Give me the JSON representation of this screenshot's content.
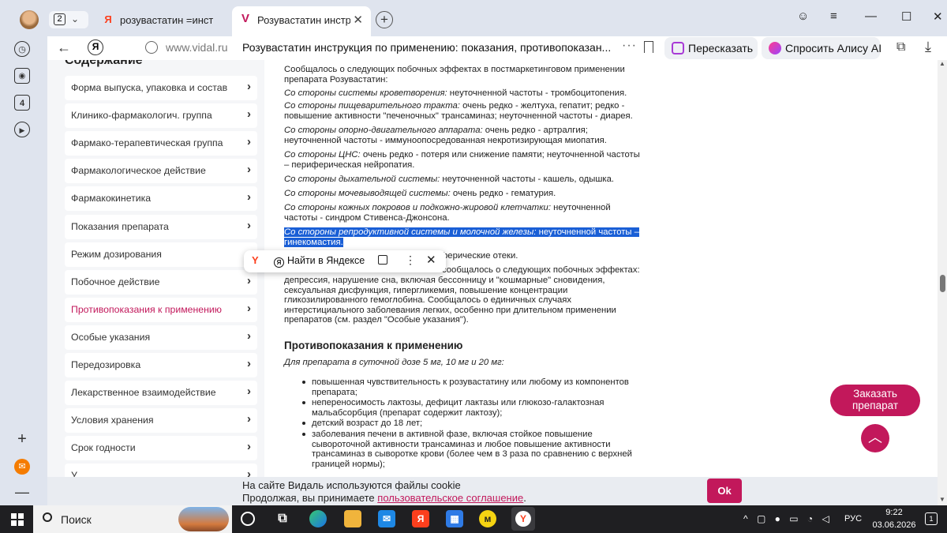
{
  "browser": {
    "tab_counter": "2",
    "tabs": [
      {
        "title": "розувастатин =инструкция",
        "favicon": "Я"
      },
      {
        "title": "Розувастатин инструкция",
        "favicon": "V"
      }
    ],
    "url": "www.vidal.ru",
    "page_title": "Розувастатин инструкция по применению: показания, противопоказан...",
    "retell_label": "Пересказать",
    "alice_label": "Спросить Алису AI",
    "sidebar_tabs_count": "4",
    "icons": [
      "back-arrow-icon",
      "yandex-icon",
      "lock-icon",
      "bookmark-icon",
      "download-icon",
      "extensions-icon"
    ]
  },
  "toc": {
    "heading": "Содержание",
    "items": [
      {
        "label": "Форма выпуска, упаковка и состав"
      },
      {
        "label": "Клинико-фармакологич. группа"
      },
      {
        "label": "Фармако-терапевтическая группа"
      },
      {
        "label": "Фармакологическое действие"
      },
      {
        "label": "Фармакокинетика"
      },
      {
        "label": "Показания препарата"
      },
      {
        "label": "Режим дозирования"
      },
      {
        "label": "Побочное действие"
      },
      {
        "label": "Противопоказания к применению"
      },
      {
        "label": "Особые указания"
      },
      {
        "label": "Передозировка"
      },
      {
        "label": "Лекарственное взаимодействие"
      },
      {
        "label": "Условия хранения"
      },
      {
        "label": "Срок годности"
      },
      {
        "label": "У..."
      }
    ],
    "active_index": 8,
    "active_color": "#c2185b"
  },
  "content": {
    "intro_1": "Сообщалось о следующих побочных эффектах в постмаркетинговом применении",
    "intro_2": "препарата Розувастатин:",
    "blood_label": "Со стороны системы кроветворения:",
    "blood_text": " неуточненной частоты - тромбоцитопения.",
    "gi_label": "Со стороны пищеварительного тракта:",
    "gi_text_1": " очень редко - желтуха, гепатит; редко -",
    "gi_text_2": "повышение активности \"печеночных\" трансаминаз; неуточненной частоты - диарея.",
    "musc_label": "Со стороны опорно-двигательного аппарата:",
    "musc_text_1": " очень редко - артралгия;",
    "musc_text_2": "неуточненной частоты - иммуноопосредованная некротизирующая миопатия.",
    "cns_label": "Со стороны ЦНС:",
    "cns_text_1": " очень редко - потеря или снижение памяти; неуточненной частоты",
    "cns_text_2": "– периферическая нейропатия.",
    "resp_label": "Со стороны дыхательной системы:",
    "resp_text": " неуточненной частоты - кашель, одышка.",
    "uro_label": "Со стороны мочевыводящей системы:",
    "uro_text": " очень редко - гематурия.",
    "skin_label": "Со стороны кожных покровов и подкожно-жировой клетчатки:",
    "skin_text_1": " неуточненной",
    "skin_text_2": "частоты - синдром Стивенса-Джонсона.",
    "repro_label": "Со стороны репродуктивной системы и молочной железы:",
    "repro_text_1": " неуточненной частоты –",
    "repro_text_2": "гинекомастия.",
    "edema_text": "ферические отеки.",
    "other_1": "сообщалось о следующих побочных эффектах:",
    "other_2": "депрессия, нарушение сна, включая бессонницу и \"кошмарные\" сновидения,",
    "other_3": "сексуальная дисфункция, гипергликемия, повышение концентрации",
    "other_4": "гликозилированного гемоглобина. Сообщалось о единичных случаях",
    "other_5": "интерстициального заболевания легких, особенно при длительном применении",
    "other_6": "препаратов (см. раздел \"Особые указания\").",
    "section_title": "Противопоказания к применению",
    "dose_note": "Для препарата в суточной дозе 5 мг, 10 мг и 20 мг:",
    "li1_1": "повышенная чувствительность к розувастатину или любому из компонентов",
    "li1_2": "препарата;",
    "li2_1": "непереносимость лактозы, дефицит лактазы или глюкозо-галактозная",
    "li2_2": "мальабсорбция (препарат содержит лактозу);",
    "li3": "детский возраст до 18 лет;",
    "li4_1": "заболевания печени в активной фазе, включая стойкое повышение",
    "li4_2": "сывороточной активности трансаминаз и любое повышение активности",
    "li4_3": "трансаминаз в сыворотке крови (более чем в 3 раза по сравнению с верхней",
    "li4_4": "границей нормы);"
  },
  "context_popup": {
    "find_label": "Найти в Яндексе"
  },
  "order_button": "Заказать препарат",
  "cookie": {
    "line1": "На сайте Видаль используются файлы cookie",
    "line2_prefix": "Продолжая, вы принимаете ",
    "link": "пользовательское соглашение",
    "line2_suffix": ".",
    "ok": "Ok"
  },
  "taskbar": {
    "search_label": "Поиск",
    "lang": "РУС",
    "time": "9:22",
    "date": "03.06.2026",
    "notifications": "1"
  },
  "accent_color": "#c2185b",
  "selection_color": "#1a5fd6"
}
